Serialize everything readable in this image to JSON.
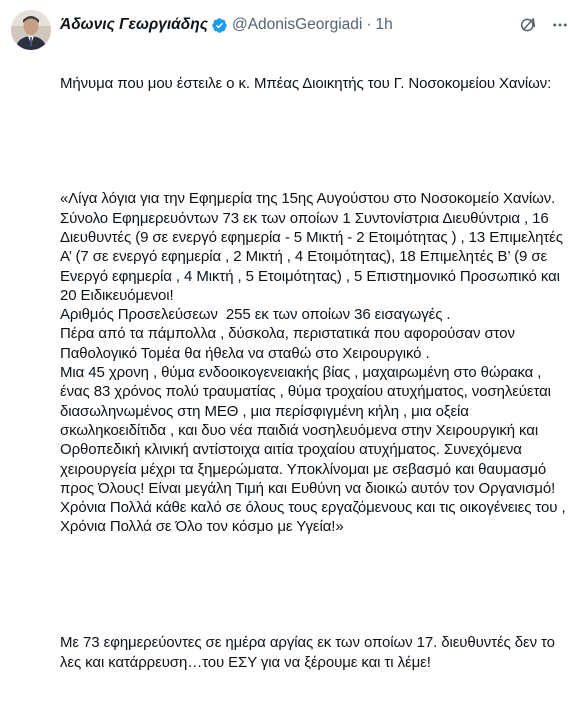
{
  "tweet": {
    "author_name": "Άδωνις Γεωργιάδης",
    "handle": "@AdonisGeorgiadi",
    "separator": "·",
    "time": "1h",
    "intro": "Μήνυμα που μου έστειλε ο κ. Μπέας Διοικητής του Γ. Νοσοκομείου Χανίων:",
    "quote": "«Λίγα λόγια για την Εφημερία της 15ης Αυγούστου στο Νοσοκομείο Χανίων.\nΣύνολο Εφημερευόντων 73 εκ των οποίων 1 Συντονίστρια Διευθύντρια , 16 Διευθυντές (9 σε ενεργό εφημερία - 5 Μικτή - 2 Ετοιμότητας ) , 13 Επιμελητές Α’ (7 σε ενεργό εφημερία , 2 Μικτή , 4 Ετοιμότητας), 18 Επιμελητές Β’ (9 σε Ενεργό εφημερία , 4 Μικτή , 5 Ετοιμότητας) , 5 Επιστημονικό Προσωπικό και 20 Ειδικευόμενοι!\nΑριθμός Προσελεύσεων  255 εκ των οποίων 36 εισαγωγές .\nΠέρα από τα πάμπολλα , δύσκολα, περιστατικά που αφορούσαν στον Παθολογικό Τομέα θα ήθελα να σταθώ στο Χειρουργικό .\nΜια 45 χρονη , θύμα ενδοοικογενειακής βίας , μαχαιρωμένη στο θώρακα , ένας 83 χρόνος πολύ τραυματίας , θύμα τροχαίου ατυχήματος, νοσηλεύεται διασωληνωμένος στη ΜΕΘ , μια περίσφιγμένη κήλη , μια οξεία σκωληκοειδίτιδα , και δυο νέα παιδιά νοσηλευόμενα στην Χειρουργική και Ορθοπεδική κλινική αντίστοιχα αιτία τροχαίου ατυχήματος. Συνεχόμενα χειρουργεία μέχρι τα ξημερώματα. Υποκλίνομαι με σεβασμό και θαυμασμό προς Όλους! Είναι μεγάλη Τιμή και Ευθύνη να διοικώ αυτόν τον Οργανισμό!\nΧρόνια Πολλά κάθε καλό σε όλους τους εργαζόμενους και τις οικογένειες του , Χρόνια Πολλά σε Όλο τον κόσμο με Υγεία!»",
    "comment": "Με 73 εφημερεύοντες σε ημέρα αργίας εκ των οποίων 17. διευθυντές δεν το λες και κατάρρευση…του ΕΣΥ για να ξέρουμε και τι λέμε!"
  },
  "icons": {
    "verified": "verified-badge-icon",
    "grok": "grok-icon",
    "more": "more-options-icon"
  },
  "colors": {
    "text": "#0f1419",
    "secondary": "#536471",
    "verified": "#1d9bf0"
  }
}
